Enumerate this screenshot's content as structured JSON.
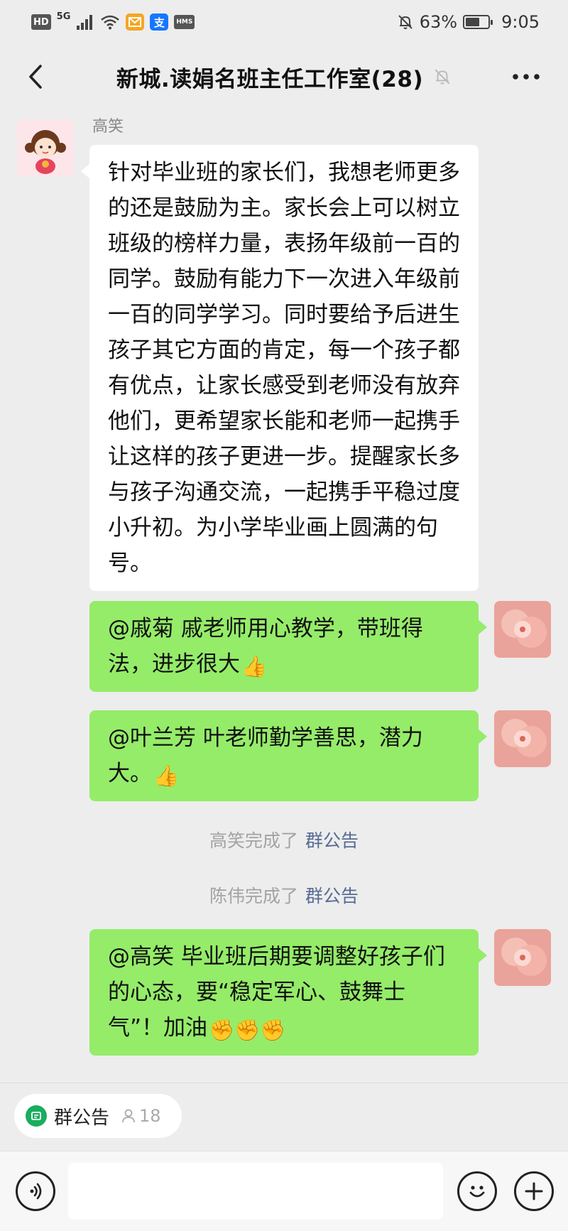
{
  "status_bar": {
    "hd": "HD",
    "net": "5G",
    "battery_percent": "63%",
    "battery_level": 0.63,
    "time": "9:05",
    "alipay_glyph": "支",
    "hms_label": "HMS",
    "icons": [
      "signal-icon",
      "wifi-icon",
      "mail-app-icon",
      "alipay-icon",
      "hms-icon",
      "bell-off-icon",
      "battery-icon"
    ]
  },
  "header": {
    "title": "新城.读娟名班主任工作室(28)",
    "back_icon": "chevron-left-icon",
    "mute_icon": "bell-off-icon",
    "more_icon": "more-icon"
  },
  "messages": [
    {
      "sender": "高笑",
      "side": "left",
      "text": "针对毕业班的家长们，我想老师更多的还是鼓励为主。家长会上可以树立班级的榜样力量，表扬年级前一百的同学。鼓励有能力下一次进入年级前一百的同学学习。同时要给予后进生孩子其它方面的肯定，每一个孩子都有优点，让家长感受到老师没有放弃他们，更希望家长能和老师一起携手让这样的孩子更进一步。提醒家长多与孩子沟通交流，一起携手平稳过度小升初。为小学毕业画上圆满的句号。"
    },
    {
      "side": "right",
      "text": "@戚菊  戚老师用心教学，带班得法，进步很大",
      "emoji": "👍"
    },
    {
      "side": "right",
      "text": "@叶兰芳  叶老师勤学善思，潜力大。",
      "emoji": "👍"
    },
    {
      "side": "right",
      "text": "@高笑  毕业班后期要调整好孩子们的心态，要“稳定军心、鼓舞士气”！加油",
      "emoji": "✊✊✊"
    }
  ],
  "system_notices": [
    {
      "text": "高笑完成了",
      "link": "群公告"
    },
    {
      "text": "陈伟完成了",
      "link": "群公告"
    }
  ],
  "bottom": {
    "notice_chip_label": "群公告",
    "notice_chip_count": "18",
    "input_placeholder": "",
    "voice_icon": "voice-icon",
    "emoji_icon": "emoji-icon",
    "plus_icon": "plus-icon"
  },
  "colors": {
    "background": "#ededed",
    "green_bubble": "#95ec69",
    "link": "#576b95",
    "notice_icon": "#19ad5e"
  }
}
